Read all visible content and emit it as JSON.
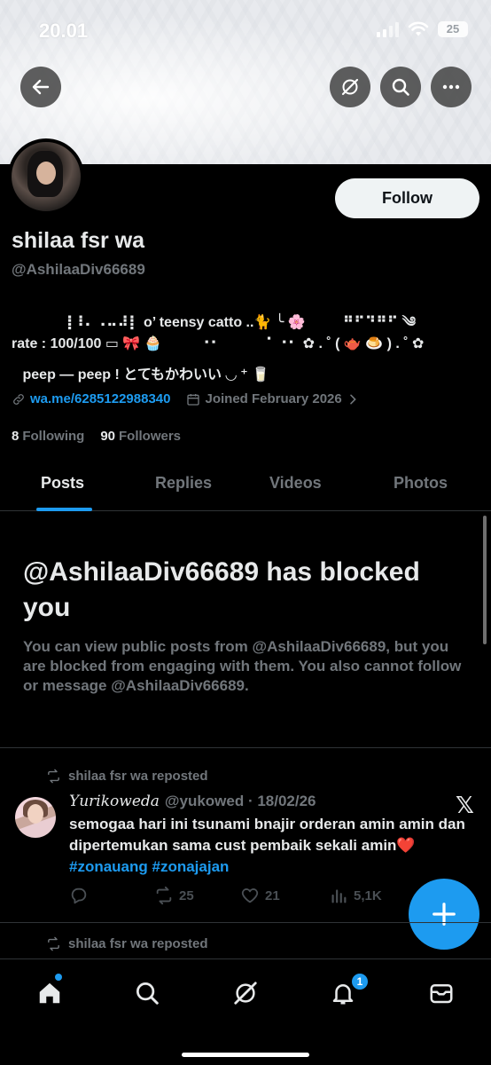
{
  "status_bar": {
    "time": "20.01",
    "battery": "25"
  },
  "profile": {
    "display_name": "shilaa fsr wa",
    "handle": "@AshilaaDiv66689",
    "follow_label": "Follow",
    "bio": [
      "⠀⠀⢸⠸⠄⠠⠤⠼⡇ o’ teensy catto ..🐈 ╰ 🌸 ⠀⠀⠀⠛⠋⠙⠛⠋ ༄",
      "rate : 100/100 ▭ 🎀 🧁 ⠀⠀⠀⠐⠂⠀⠀⠀⠀⠁⠐⠂ ✿ . ˚ ( 🫖 🍮 ) . ˚ ✿",
      "⠀peep — peep ! とてもかわいい ◡ ⁺ 🥛"
    ],
    "link": "wa.me/6285122988340",
    "joined": "Joined February 2026",
    "following_count": "8",
    "following_label": "Following",
    "followers_count": "90",
    "followers_label": "Followers"
  },
  "tabs": [
    "Posts",
    "Replies",
    "Videos",
    "Photos"
  ],
  "active_tab": "Posts",
  "blocked": {
    "title": "@AshilaaDiv66689 has blocked you",
    "body": "You can view public posts from @AshilaaDiv66689, but you are blocked from engaging with them. You also cannot follow or message @AshilaaDiv66689."
  },
  "posts": [
    {
      "repost_label": "shilaa fsr wa reposted",
      "author_name": "𝑌𝑢𝑟𝑖𝑘𝑜𝑤𝑒𝑑𝑎",
      "author_meta": "@yukowed · 18/02/26",
      "text": "semogaa hari ini tsunami bnajir orderan amin amin dan dipertemukan sama cust pembaik sekali amin❤️",
      "hashtags": "#zonauang #zonajajan",
      "retweets": "25",
      "likes": "21",
      "views": "5,1K"
    }
  ],
  "next_repost_label": "shilaa fsr wa reposted",
  "nav": {
    "notification_badge": "1"
  },
  "colors": {
    "accent": "#1d9bf0",
    "background": "#000000",
    "muted": "#71767b"
  }
}
